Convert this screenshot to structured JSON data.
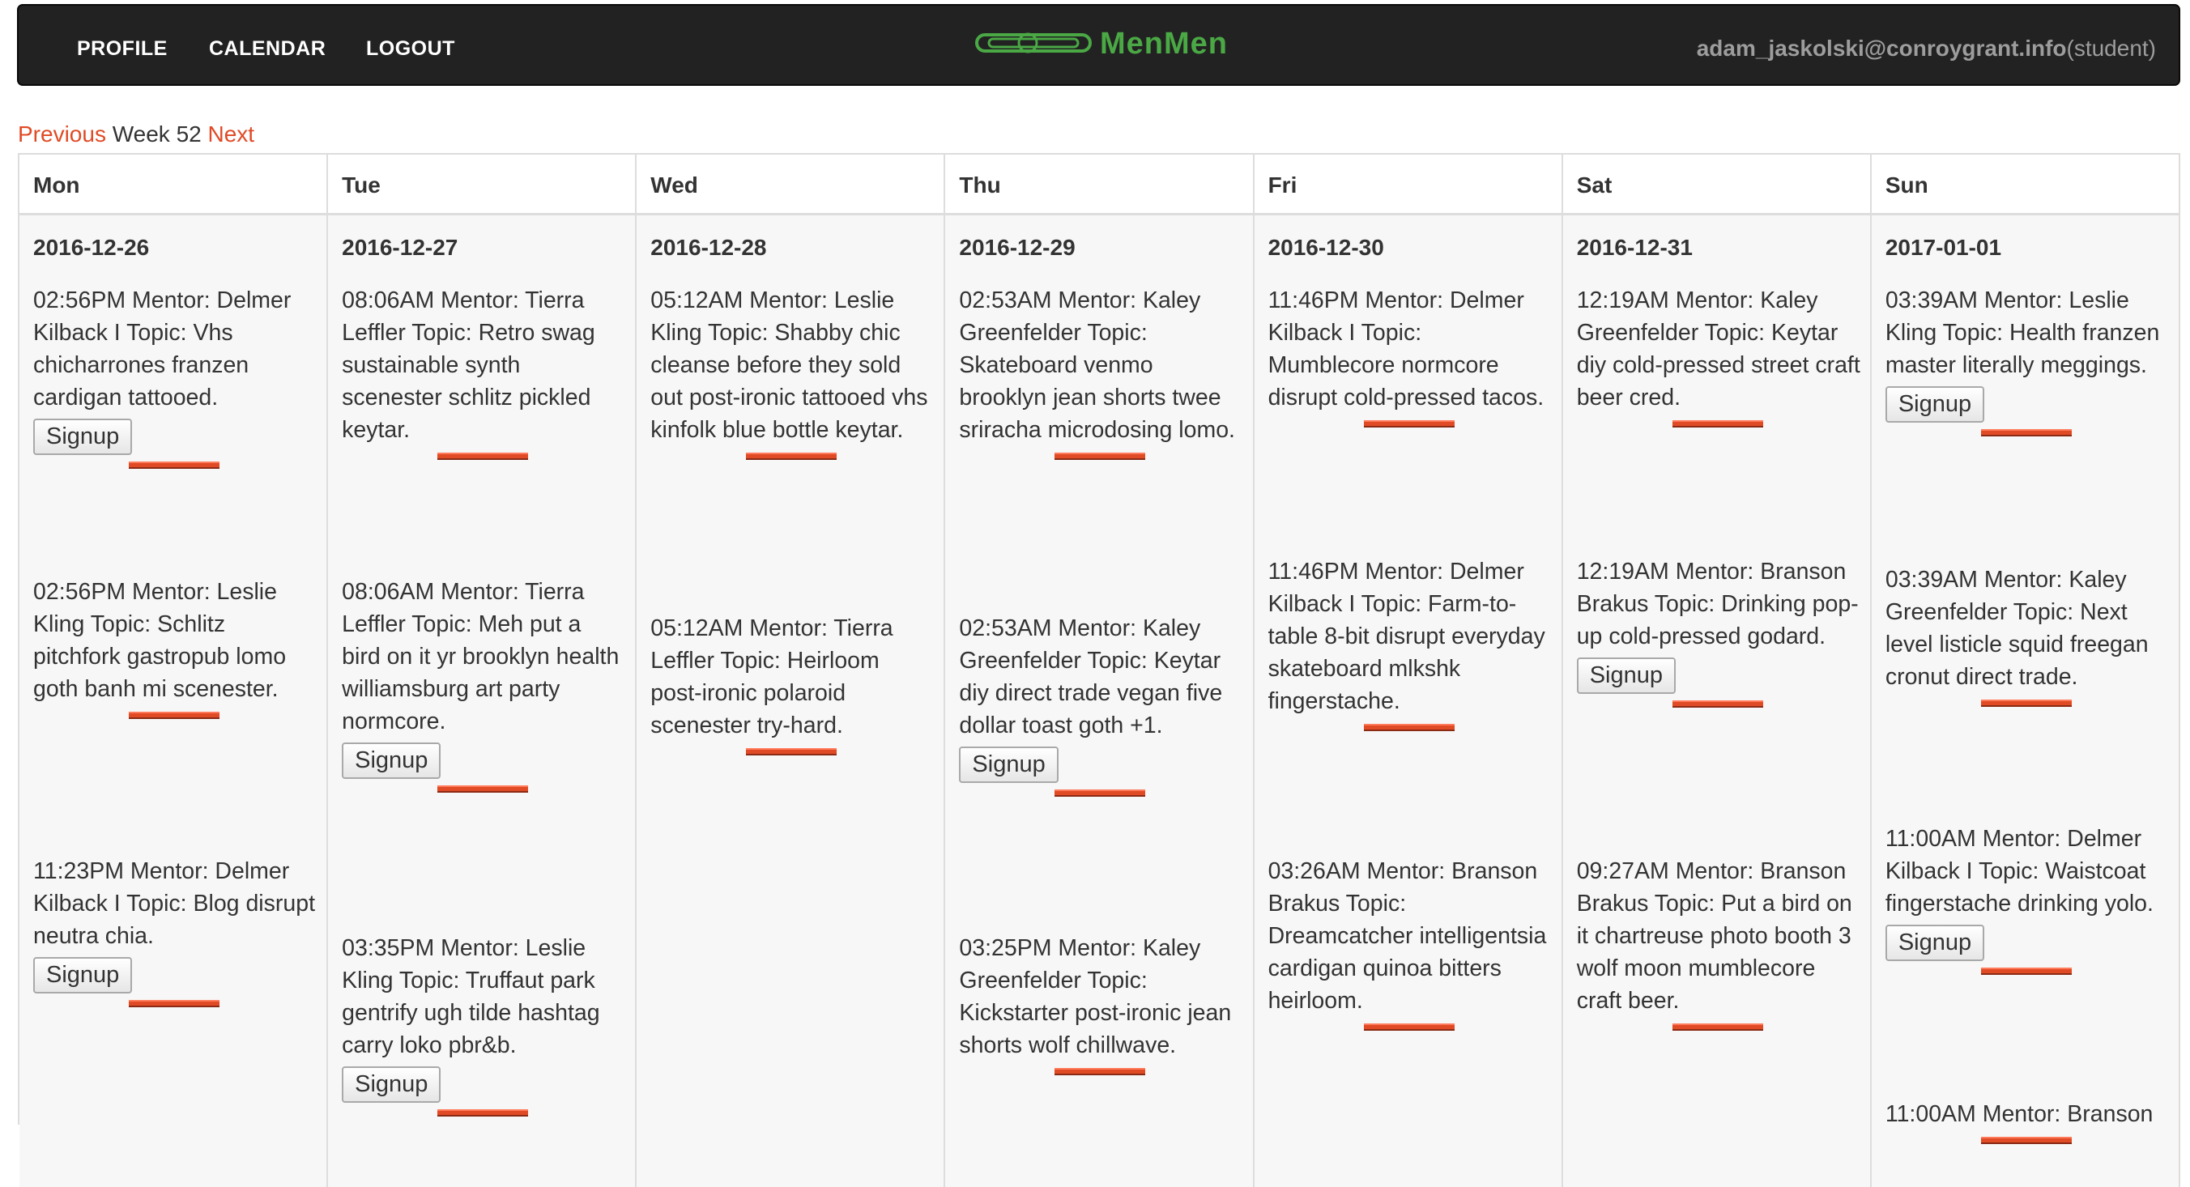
{
  "nav": {
    "profile": "PROFILE",
    "calendar": "CALENDAR",
    "logout": "LOGOUT",
    "brand": "MenMen",
    "user_email": "adam_jaskolski@conroygrant.info",
    "user_role": "(student)"
  },
  "week_nav": {
    "previous": "Previous",
    "week": "Week 52",
    "next": "Next"
  },
  "signup_label": "Signup",
  "colors": {
    "accent": "#e04a25",
    "brand": "#4aa845",
    "navbar": "#222222"
  },
  "days": [
    {
      "name": "Mon",
      "date": "2016-12-26",
      "slots": [
        {
          "text": "02:56PM Mentor: Delmer Kilback I Topic: Vhs chicharrones franzen cardigan tattooed.",
          "signup": true
        },
        {
          "text": "02:56PM Mentor: Leslie Kling Topic: Schlitz pitchfork gastropub lomo goth banh mi scenester.",
          "signup": false
        },
        {
          "text": "11:23PM Mentor: Delmer Kilback I Topic: Blog disrupt neutra chia.",
          "signup": true
        }
      ]
    },
    {
      "name": "Tue",
      "date": "2016-12-27",
      "slots": [
        {
          "text": "08:06AM Mentor: Tierra Leffler Topic: Retro swag sustainable synth scenester schlitz pickled keytar.",
          "signup": false
        },
        {
          "text": "08:06AM Mentor: Tierra Leffler Topic: Meh put a bird on it yr brooklyn health williamsburg art party normcore.",
          "signup": true
        },
        {
          "text": "03:35PM Mentor: Leslie Kling Topic: Truffaut park gentrify ugh tilde hashtag carry loko pbr&b.",
          "signup": true
        }
      ]
    },
    {
      "name": "Wed",
      "date": "2016-12-28",
      "slots": [
        {
          "text": "05:12AM Mentor: Leslie Kling Topic: Shabby chic cleanse before they sold out post-ironic tattooed vhs kinfolk blue bottle keytar.",
          "signup": false
        },
        {
          "text": "05:12AM Mentor: Tierra Leffler Topic: Heirloom post-ironic polaroid scenester try-hard.",
          "signup": false
        }
      ]
    },
    {
      "name": "Thu",
      "date": "2016-12-29",
      "slots": [
        {
          "text": "02:53AM Mentor: Kaley Greenfelder Topic: Skateboard venmo brooklyn jean shorts twee sriracha microdosing lomo.",
          "signup": false
        },
        {
          "text": "02:53AM Mentor: Kaley Greenfelder Topic: Keytar diy direct trade vegan five dollar toast goth +1.",
          "signup": true
        },
        {
          "text": "03:25PM Mentor: Kaley Greenfelder Topic: Kickstarter post-ironic jean shorts wolf chillwave.",
          "signup": false
        }
      ]
    },
    {
      "name": "Fri",
      "date": "2016-12-30",
      "slots": [
        {
          "text": "11:46PM Mentor: Delmer Kilback I Topic: Mumblecore normcore disrupt cold-pressed tacos.",
          "signup": false
        },
        {
          "text": "11:46PM Mentor: Delmer Kilback I Topic: Farm-to-table 8-bit disrupt everyday skateboard mlkshk fingerstache.",
          "signup": false
        },
        {
          "text": "03:26AM Mentor: Branson Brakus Topic: Dreamcatcher intelligentsia cardigan quinoa bitters heirloom.",
          "signup": false
        }
      ]
    },
    {
      "name": "Sat",
      "date": "2016-12-31",
      "slots": [
        {
          "text": "12:19AM Mentor: Kaley Greenfelder Topic: Keytar diy cold-pressed street craft beer cred.",
          "signup": false
        },
        {
          "text": "12:19AM Mentor: Branson Brakus Topic: Drinking pop-up cold-pressed godard.",
          "signup": true
        },
        {
          "text": "09:27AM Mentor: Branson Brakus Topic: Put a bird on it chartreuse photo booth 3 wolf moon mumblecore craft beer.",
          "signup": false
        }
      ]
    },
    {
      "name": "Sun",
      "date": "2017-01-01",
      "slots": [
        {
          "text": "03:39AM Mentor: Leslie Kling Topic: Health franzen master literally meggings.",
          "signup": true
        },
        {
          "text": "03:39AM Mentor: Kaley Greenfelder Topic: Next level listicle squid freegan cronut direct trade.",
          "signup": false
        },
        {
          "text": "11:00AM Mentor: Delmer Kilback I Topic: Waistcoat fingerstache drinking yolo.",
          "signup": true
        },
        {
          "text": "11:00AM Mentor: Branson",
          "signup": false
        }
      ]
    }
  ]
}
